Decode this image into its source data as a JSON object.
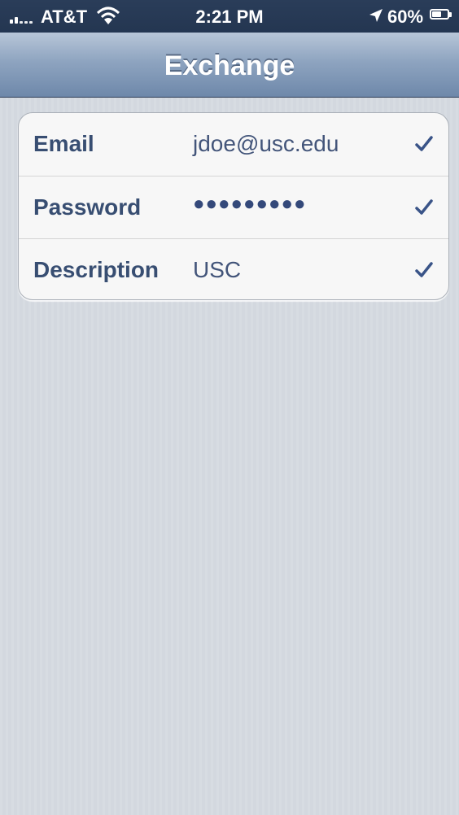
{
  "status_bar": {
    "carrier": "AT&T",
    "time": "2:21 PM",
    "battery_percent": "60%",
    "battery_level": 0.6,
    "icons": [
      "signal-icon",
      "wifi-icon",
      "location-arrow-icon",
      "battery-icon"
    ]
  },
  "nav": {
    "title": "Exchange"
  },
  "form": {
    "rows": [
      {
        "label": "Email",
        "value": "jdoe@usc.edu",
        "validated": true
      },
      {
        "label": "Password",
        "value": "●●●●●●●●●",
        "validated": true
      },
      {
        "label": "Description",
        "value": "USC",
        "validated": true
      }
    ]
  },
  "colors": {
    "status_bar": "#243651",
    "nav_bar_top": "#b8c6d8",
    "nav_bar_bottom": "#6e88aa",
    "label_text": "#384e72",
    "value_text": "#43557a",
    "checkmark": "#3a5488",
    "background": "#d3d8df"
  }
}
